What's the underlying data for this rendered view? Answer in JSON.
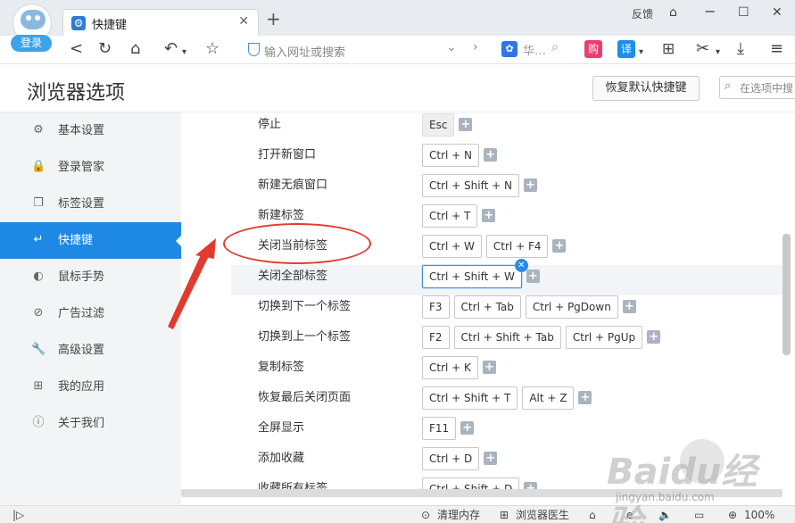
{
  "browser": {
    "login_label": "登录",
    "tab_title": "快捷键",
    "new_tab_icon": "plus-icon",
    "feedback_label": "反馈",
    "address_placeholder": "输入网址或搜索",
    "search_engine_label": "华…",
    "shop_label": "购",
    "translate_label": "译"
  },
  "settings": {
    "title": "浏览器选项",
    "restore_button": "恢复默认快捷键",
    "search_placeholder": "在选项中搜"
  },
  "sidebar": {
    "items": [
      {
        "label": "基本设置",
        "icon": "gear-icon"
      },
      {
        "label": "登录管家",
        "icon": "lock-icon"
      },
      {
        "label": "标签设置",
        "icon": "tabs-icon"
      },
      {
        "label": "快捷键",
        "icon": "keyboard-icon",
        "active": true
      },
      {
        "label": "鼠标手势",
        "icon": "mouse-icon"
      },
      {
        "label": "广告过滤",
        "icon": "block-icon"
      },
      {
        "label": "高级设置",
        "icon": "wrench-icon"
      },
      {
        "label": "我的应用",
        "icon": "apps-icon"
      },
      {
        "label": "关于我们",
        "icon": "info-icon"
      }
    ]
  },
  "shortcuts": [
    {
      "label": "停止",
      "keys": [
        [
          "Esc"
        ]
      ]
    },
    {
      "label": "打开新窗口",
      "keys": [
        [
          "Ctrl",
          "N"
        ]
      ]
    },
    {
      "label": "新建无痕窗口",
      "keys": [
        [
          "Ctrl",
          "Shift",
          "N"
        ]
      ]
    },
    {
      "label": "新建标签",
      "keys": [
        [
          "Ctrl",
          "T"
        ]
      ]
    },
    {
      "label": "关闭当前标签",
      "keys": [
        [
          "Ctrl",
          "W"
        ],
        [
          "Ctrl",
          "F4"
        ]
      ]
    },
    {
      "label": "关闭全部标签",
      "keys": [
        [
          "Ctrl",
          "Shift",
          "W"
        ]
      ]
    },
    {
      "label": "切换到下一个标签",
      "keys": [
        [
          "F3"
        ],
        [
          "Ctrl",
          "Tab"
        ],
        [
          "Ctrl",
          "PgDown"
        ]
      ]
    },
    {
      "label": "切换到上一个标签",
      "keys": [
        [
          "F2"
        ],
        [
          "Ctrl",
          "Shift",
          "Tab"
        ],
        [
          "Ctrl",
          "PgUp"
        ]
      ]
    },
    {
      "label": "复制标签",
      "keys": [
        [
          "Ctrl",
          "K"
        ]
      ]
    },
    {
      "label": "恢复最后关闭页面",
      "keys": [
        [
          "Ctrl",
          "Shift",
          "T"
        ],
        [
          "Alt",
          "Z"
        ]
      ]
    },
    {
      "label": "全屏显示",
      "keys": [
        [
          "F11"
        ]
      ]
    },
    {
      "label": "添加收藏",
      "keys": [
        [
          "Ctrl",
          "D"
        ]
      ]
    },
    {
      "label": "收藏所有标签",
      "keys": [
        [
          "Ctrl",
          "Shift",
          "D"
        ]
      ]
    }
  ],
  "statusbar": {
    "clear_memory": "清理内存",
    "browser_doctor": "浏览器医生",
    "zoom": "100%"
  },
  "watermark": {
    "brand": "Baidu经验",
    "url": "jingyan.baidu.com"
  },
  "colors": {
    "accent": "#1e88e5",
    "annotation": "#e23a2e"
  }
}
